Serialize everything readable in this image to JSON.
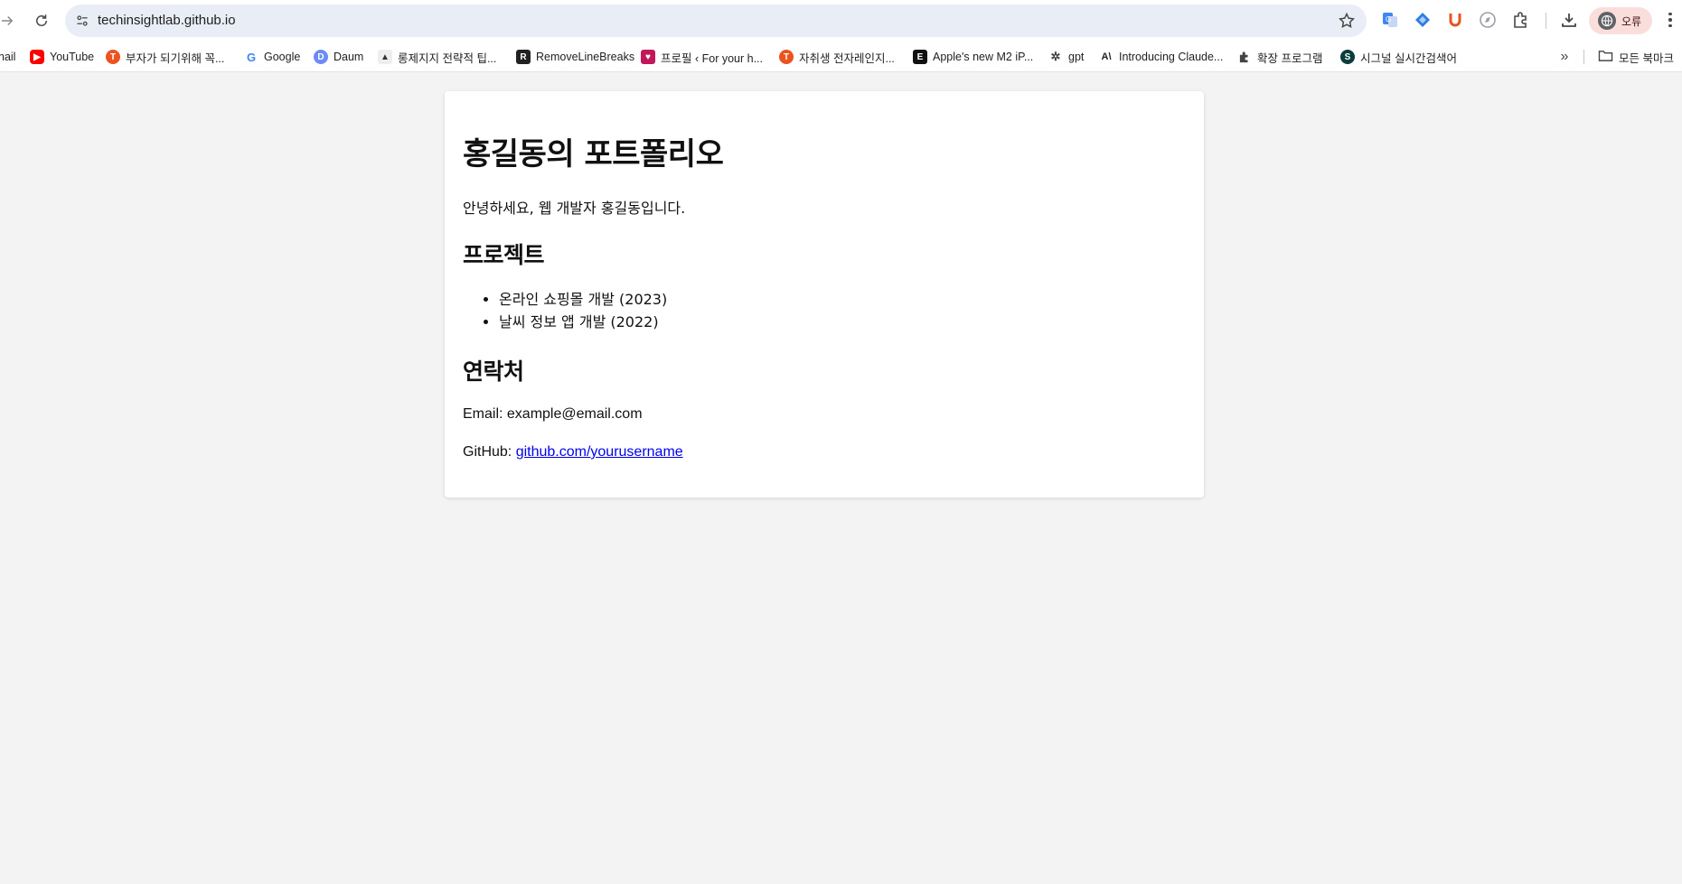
{
  "browser": {
    "url": "techinsightlab.github.io",
    "profile_label": "오류",
    "bookmarks": [
      {
        "label": "nail",
        "icon": "gmail-icon",
        "color": "#ffffff"
      },
      {
        "label": "YouTube",
        "icon": "youtube-icon",
        "color": "#ff0000"
      },
      {
        "label": "부자가 되기위해 꼭...",
        "icon": "tistory-icon",
        "color": "#eb531f"
      },
      {
        "label": "Google",
        "icon": "google-icon",
        "color": "#4285f4"
      },
      {
        "label": "Daum",
        "icon": "daum-icon",
        "color": "#6b8cf5"
      },
      {
        "label": "롱제지지 전략적 팁...",
        "icon": "penguin-icon",
        "color": "#555555"
      },
      {
        "label": "RemoveLineBreaks",
        "icon": "r-icon",
        "color": "#222222"
      },
      {
        "label": "프로필 ‹ For your h...",
        "icon": "profile-site-icon",
        "color": "#c2185b"
      },
      {
        "label": "자취생 전자레인지...",
        "icon": "tistory-icon",
        "color": "#eb531f"
      },
      {
        "label": "Apple's new M2 iP...",
        "icon": "engadget-icon",
        "color": "#111111"
      },
      {
        "label": "gpt",
        "icon": "openai-icon",
        "color": "#444444"
      },
      {
        "label": "Introducing Claude...",
        "icon": "anthropic-icon",
        "color": "#222222"
      },
      {
        "label": "확장 프로그램",
        "icon": "puzzle-icon",
        "color": "#444444"
      },
      {
        "label": "시그널 실시간검색어",
        "icon": "signal-icon",
        "color": "#0b3d3a"
      }
    ],
    "bookmarks_folder": "모든 북마크"
  },
  "page": {
    "title": "홍길동의 포트폴리오",
    "intro": "안녕하세요, 웹 개발자 홍길동입니다.",
    "projects_heading": "프로젝트",
    "projects": [
      "온라인 쇼핑몰 개발 (2023)",
      "날씨 정보 앱 개발 (2022)"
    ],
    "contact_heading": "연락처",
    "email_line": "Email: example@email.com",
    "github_prefix": "GitHub: ",
    "github_link": "github.com/yourusername"
  }
}
